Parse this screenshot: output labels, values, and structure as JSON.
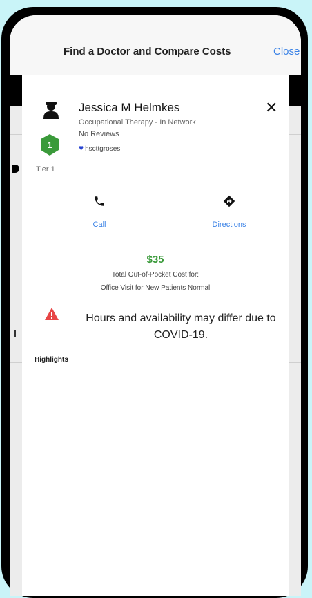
{
  "header": {
    "title": "Find a Doctor and Compare Costs",
    "close_label": "Close"
  },
  "provider": {
    "name": "Jessica M Helmkes",
    "specialty": "Occupational Therapy - In Network",
    "reviews": "No Reviews",
    "badge_label": "hscttgroses",
    "tier_number": "1",
    "tier_label": "Tier 1",
    "tier_color": "#3a9a3a"
  },
  "actions": {
    "call_label": "Call",
    "directions_label": "Directions"
  },
  "cost": {
    "amount": "$35",
    "line1": "Total Out-of-Pocket Cost for:",
    "line2": "Office Visit for New Patients Normal"
  },
  "notice": {
    "text": "Hours and availability may differ due to COVID-19.",
    "icon_color": "#e84545"
  },
  "section": {
    "highlights_label": "Highlights"
  },
  "colors": {
    "accent": "#3a82e6",
    "price": "#3a9a3a",
    "heart": "#2945d1"
  }
}
